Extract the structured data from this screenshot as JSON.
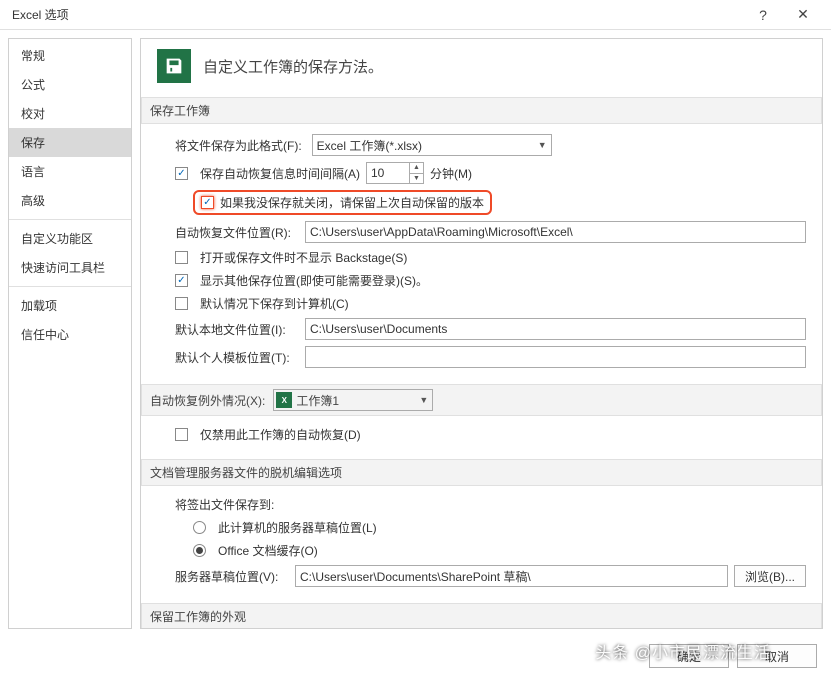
{
  "titlebar": {
    "title": "Excel 选项"
  },
  "sidebar": {
    "items": [
      "常规",
      "公式",
      "校对",
      "保存",
      "语言",
      "高级",
      "自定义功能区",
      "快速访问工具栏",
      "加载项",
      "信任中心"
    ],
    "selected_label": "保存"
  },
  "header": {
    "text": "自定义工作簿的保存方法。"
  },
  "sections": {
    "save_workbooks": {
      "title": "保存工作簿",
      "format_label": "将文件保存为此格式(F):",
      "format_value": "Excel 工作簿(*.xlsx)",
      "autosave_label": "保存自动恢复信息时间间隔(A)",
      "autosave_value": "10",
      "autosave_unit": "分钟(M)",
      "keep_last_label": "如果我没保存就关闭，请保留上次自动保留的版本",
      "autorecover_loc_label": "自动恢复文件位置(R):",
      "autorecover_loc_value": "C:\\Users\\user\\AppData\\Roaming\\Microsoft\\Excel\\",
      "no_backstage_label": "打开或保存文件时不显示 Backstage(S)",
      "show_other_label": "显示其他保存位置(即使可能需要登录)(S)。",
      "save_computer_label": "默认情况下保存到计算机(C)",
      "default_local_label": "默认本地文件位置(I):",
      "default_local_value": "C:\\Users\\user\\Documents",
      "personal_template_label": "默认个人模板位置(T):",
      "personal_template_value": ""
    },
    "autorecover_exceptions": {
      "title": "自动恢复例外情况(X):",
      "workbook": "工作簿1",
      "disable_label": "仅禁用此工作簿的自动恢复(D)"
    },
    "offline_editing": {
      "title": "文档管理服务器文件的脱机编辑选项",
      "save_to_label": "将签出文件保存到:",
      "opt1": "此计算机的服务器草稿位置(L)",
      "opt2": "Office 文档缓存(O)",
      "server_draft_label": "服务器草稿位置(V):",
      "server_draft_value": "C:\\Users\\user\\Documents\\SharePoint 草稿\\",
      "browse": "浏览(B)..."
    },
    "appearance": {
      "title": "保留工作簿的外观"
    }
  },
  "footer": {
    "ok": "确定",
    "cancel": "取消"
  },
  "watermark": "头条 @小市民漂流生活"
}
